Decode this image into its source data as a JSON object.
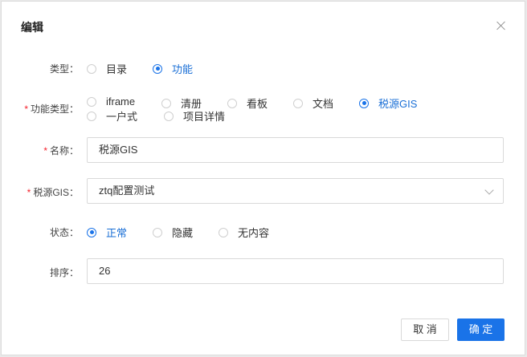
{
  "dialog": {
    "title": "编辑"
  },
  "form": {
    "type": {
      "label": "类型：",
      "options": [
        {
          "label": "目录",
          "selected": false
        },
        {
          "label": "功能",
          "selected": true
        }
      ]
    },
    "function_type": {
      "required": "*",
      "label": "功能类型：",
      "options": [
        {
          "label": "iframe",
          "selected": false
        },
        {
          "label": "清册",
          "selected": false
        },
        {
          "label": "看板",
          "selected": false
        },
        {
          "label": "文档",
          "selected": false
        },
        {
          "label": "税源GIS",
          "selected": true
        },
        {
          "label": "一户式",
          "selected": false
        },
        {
          "label": "项目详情",
          "selected": false
        }
      ]
    },
    "name": {
      "required": "*",
      "label": "名称：",
      "value": "税源GIS"
    },
    "gis": {
      "required": "*",
      "label": "税源GIS：",
      "value": "ztq配置测试"
    },
    "status": {
      "label": "状态：",
      "options": [
        {
          "label": "正常",
          "selected": true
        },
        {
          "label": "隐藏",
          "selected": false
        },
        {
          "label": "无内容",
          "selected": false
        }
      ]
    },
    "order": {
      "label": "排序：",
      "value": "26"
    }
  },
  "footer": {
    "cancel_label": "取 消",
    "ok_label": "确 定"
  },
  "colors": {
    "accent": "#1a73e8",
    "required": "#f5222d"
  }
}
